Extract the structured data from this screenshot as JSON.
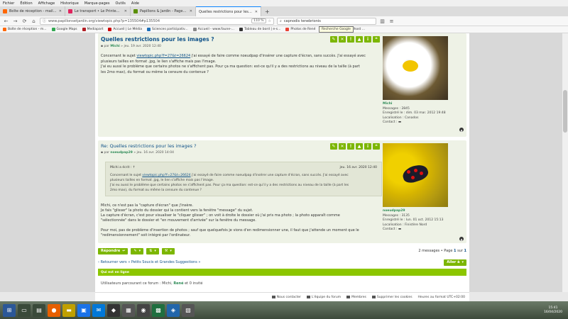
{
  "menu": [
    "Fichier",
    "Édition",
    "Affichage",
    "Historique",
    "Marque-pages",
    "Outils",
    "Aide"
  ],
  "tabs": [
    {
      "label": "Boîte de réception - mail Orange",
      "color": "#ff6600",
      "active": false
    },
    {
      "label": "Le transport • Le Printemps Mi...",
      "color": "#e0245e",
      "active": false
    },
    {
      "label": "Papillons & Jardin - Page d'index",
      "color": "#5a8f00",
      "active": false
    },
    {
      "label": "Quelles restrictions pour les images ?",
      "color": "#5a8f00",
      "active": true
    }
  ],
  "nav": {
    "url": "www.papillonsetjardin.org/viewtopic.php?p=135504#p135504",
    "zoom": "110 %",
    "search_value": "capnodis tenebrionis",
    "search_tooltip": "Recherche Google"
  },
  "bookmarks": [
    {
      "label": "Boîte de réception - m...",
      "color": "#ff6600"
    },
    {
      "label": "Google Maps",
      "color": "#34a853"
    },
    {
      "label": "Mediapart",
      "color": "#b21e24"
    },
    {
      "label": "Accueil | Le Média",
      "color": "#c00"
    },
    {
      "label": "Sciences participativ...",
      "color": "#1d70b8"
    },
    {
      "label": "Accueil - www.faune-...",
      "color": "#888"
    },
    {
      "label": "Tableau de bord | e-s...",
      "color": "#333"
    },
    {
      "label": "Photos de René",
      "color": "#e94235"
    },
    {
      "label": "Généalogie -Localhost ...",
      "color": "#777"
    }
  ],
  "post1": {
    "title": "Quelles restrictions pour les images ?",
    "meta_prefix": "par",
    "author": "Michi",
    "date": "» jeu. 19 avr. 2020 12:40",
    "line1_a": "Concernant le sujet",
    "line1_link": "viewtopic.php?f=27&t=26624",
    "line1_b": "j'ai essayé de faire comme noeudpap d'insérer une capture d'écran, sans succès. J'ai essayé avec",
    "line2": "plusieurs tailles en format .jpg, le lien s'affiche mais pas l'image.",
    "line3": "J'ai eu aussi le problème que certains photos ne s'affichent pas. Pour ça ma question: est-ce qu'il y a des restrictions au niveau de la taille (à part",
    "line4": "les 2mo max), du format ou même la censure du contenue ?",
    "profile": {
      "badge": "En ligne",
      "name": "Michi",
      "messages": "Messages : 2845",
      "registered": "Enregistré le : dim. 03 mar. 2012 19:48",
      "location": "Localisation : Canados",
      "contact": "Contact :"
    }
  },
  "post2": {
    "title": "Re: Quelles restrictions pour les images ?",
    "meta_prefix": "par",
    "author": "noeudpap29",
    "date": "» jeu. 16 avr. 2020 14:04",
    "quote_author": "Michi a écrit : ↑",
    "quote_date": "jeu. 16 avr. 2020 12:40",
    "quote_line1_a": "Concernant le sujet",
    "quote_line1_link": "viewtopic.php?f=27&t=26624",
    "quote_line1_b": "j'ai essayé de faire comme noeudpap d'insérer une capture d'écran, sans succès. J'ai essayé avec",
    "quote_line2": "plusieurs tailles en format .jpg, le lien s'affiche mais pas l'image.",
    "quote_line3": "J'ai eu aussi le problème que certains photos ne s'affichent pas. Pour ça ma question: est-ce qu'il y a des restrictions au niveau de la taille (à part les",
    "quote_line4": "2mo max), du format ou même la censure du contenue ?",
    "reply1": "Michi, ce n'est pas la \"capture d'écran\" que j'insère.",
    "reply2": "Je fais \"glisser\" la photo du dossier qui la contient vers la fenêtre \"message\" du sujet.",
    "reply3": "La capture d'écran, c'est pour visualiser le \"cliquer glisser\" ; on voit à droite le dossier où j'ai pris ma photo ; la photo apparaît comme",
    "reply4": "\"sélectionnée\" dans le dossier et \"en mouvement d'arrivée\" sur la fenêtre du message.",
    "reply5": "Pour moi, pas de problème d'insertion de photos ; sauf que quelquefois je vions d'en redimensionner une, il faut que j'attende un moment que le",
    "reply6": "\"redimensionnement\" soit intégré par l'ordinateur.",
    "profile": {
      "name": "noeudpap29",
      "messages": "Messages : 3135",
      "registered": "Enregistré le : lun. 01 oct. 2012 15:13",
      "location": "Localisation : Finistère Nord",
      "contact": "Contact :"
    }
  },
  "actions": {
    "reply": "Répondre",
    "page_count_prefix": "2 messages • Page",
    "page_current": "1",
    "page_sep": "sur",
    "page_total": "1"
  },
  "return_link": "‹  Retourner vers « Petits Soucis et Grandes Suggestions »",
  "goto": "Aller à",
  "online": {
    "band": "Qui est en ligne",
    "text_a": "Utilisateurs parcourant ce forum :",
    "user1": "Michi",
    "user2": "René",
    "text_b": "et 0 invité"
  },
  "footer": {
    "contact": "Nous contacter",
    "team": "L'équipe du forum",
    "members": "Membres",
    "cookies": "Supprimer les cookies",
    "timezone": "Heures au format UTC+02:00"
  },
  "clock": {
    "time": "15:41",
    "date": "16/04/2020"
  }
}
